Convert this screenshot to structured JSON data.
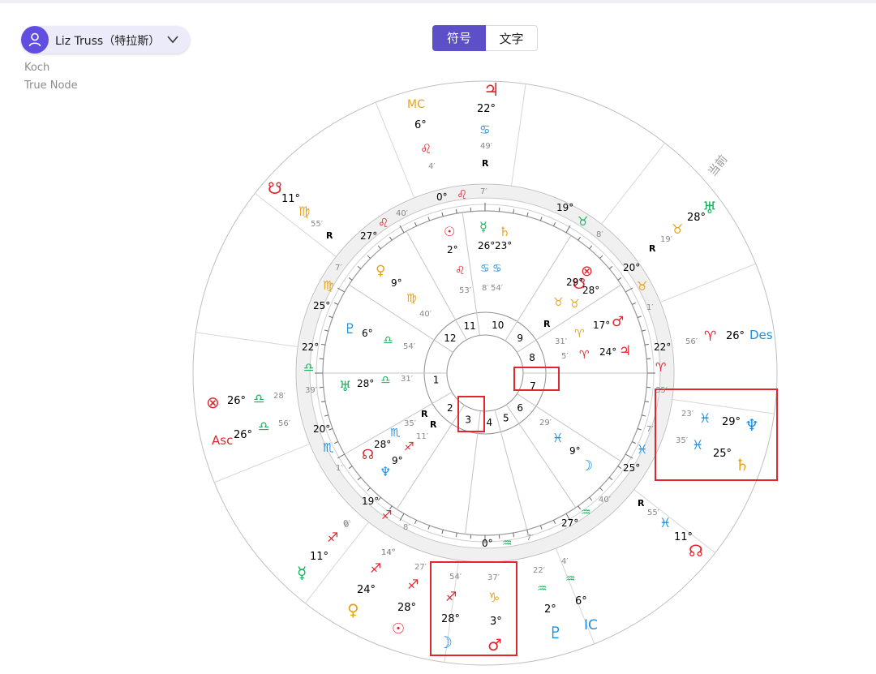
{
  "profile": {
    "name": "Liz Truss（特拉斯）",
    "house_system": "Koch",
    "node_type": "True Node"
  },
  "view_toggle": {
    "symbol_label": "符号",
    "text_label": "文字"
  },
  "outer_ring_label": "当前",
  "colors": {
    "fire": "#e0262e",
    "earth": "#e8a317",
    "air": "#13b35a",
    "water": "#1e8fe0",
    "accent": "#5c4fc8",
    "highlight": "#e0262e"
  },
  "houses": [
    "1",
    "2",
    "3",
    "4",
    "5",
    "6",
    "7",
    "8",
    "9",
    "10",
    "11",
    "12"
  ],
  "house_cusps": [
    {
      "deg": "0°",
      "sign": "♌",
      "min": "7′"
    },
    {
      "deg": "27°",
      "sign": "♌",
      "min": "40′"
    },
    {
      "deg": "25°",
      "sign": "♍",
      "min": "7′"
    },
    {
      "deg": "22°",
      "sign": "♎",
      "min": "39′"
    },
    {
      "deg": "20°",
      "sign": "♏",
      "min": "1′"
    },
    {
      "deg": "19°",
      "sign": "♐",
      "min": "0′"
    },
    {
      "deg": "14°",
      "sign": "",
      "min": "8′"
    },
    {
      "deg": "0°",
      "sign": "♒",
      "min": "7′"
    },
    {
      "deg": "27°",
      "sign": "♒",
      "min": "40′"
    },
    {
      "deg": "25°",
      "sign": "♓",
      "min": "7′"
    },
    {
      "deg": "22°",
      "sign": "♈",
      "min": "35′"
    },
    {
      "deg": "20°",
      "sign": "♉",
      "min": "1′"
    },
    {
      "deg": "19°",
      "sign": "♉",
      "min": "8′"
    }
  ],
  "natal_planets": [
    {
      "glyph": "☉",
      "deg": "2°",
      "sign": "♌",
      "min": "53′"
    },
    {
      "glyph": "☿",
      "deg": "26°",
      "sign": "♋",
      "min": "8′"
    },
    {
      "glyph": "♄",
      "deg": "23°",
      "sign": "♋",
      "min": "54′"
    },
    {
      "glyph": "♀",
      "deg": "9°",
      "sign": "♍",
      "min": "40′"
    },
    {
      "glyph": "♇",
      "deg": "6°",
      "sign": "♎",
      "min": "54′"
    },
    {
      "glyph": "♅",
      "deg": "28°",
      "sign": "♎",
      "min": "31′"
    },
    {
      "glyph": "☊",
      "deg": "28°",
      "sign": "♏",
      "min": "35′"
    },
    {
      "glyph": "♆",
      "deg": "9°",
      "sign": "♐",
      "min": "11′"
    },
    {
      "glyph": "♓",
      "deg": "9°",
      "sign": "♓",
      "min": "29′"
    },
    {
      "glyph": "☽",
      "deg": "9°",
      "sign": "♓",
      "min": ""
    },
    {
      "glyph": "☋",
      "deg": "28°",
      "sign": "♉",
      "min": "5′"
    },
    {
      "glyph": "⊗",
      "deg": "29°",
      "sign": "♉",
      "min": ""
    },
    {
      "glyph": "♂",
      "deg": "17°",
      "sign": "♈",
      "min": "31′"
    },
    {
      "glyph": "♃",
      "deg": "24°",
      "sign": "♈",
      "min": "5′"
    }
  ],
  "transit_planets": [
    {
      "glyph": "♃",
      "deg": "22°",
      "sign": "♋",
      "min": "49′",
      "retro": "R"
    },
    {
      "glyph": "MC",
      "deg": "6°",
      "sign": "♌",
      "min": "4′"
    },
    {
      "glyph": "☋",
      "deg": "11°",
      "sign": "♍",
      "min": "55′"
    },
    {
      "glyph": "♅",
      "deg": "28°",
      "sign": "♉",
      "min": "19′"
    },
    {
      "glyph": "Des",
      "deg": "26°",
      "sign": "♈",
      "min": "56′"
    },
    {
      "glyph": "♆",
      "deg": "29°",
      "sign": "♓",
      "min": "23′"
    },
    {
      "glyph": "♄",
      "deg": "25°",
      "sign": "♓",
      "min": "35′"
    },
    {
      "glyph": "☊",
      "deg": "11°",
      "sign": "♓",
      "min": "55′",
      "retro": "R"
    },
    {
      "glyph": "IC",
      "deg": "6°",
      "sign": "♒",
      "min": "4′"
    },
    {
      "glyph": "♇",
      "deg": "2°",
      "sign": "♒",
      "min": "22′"
    },
    {
      "glyph": "♂",
      "deg": "3°",
      "sign": "♑",
      "min": "37′"
    },
    {
      "glyph": "☽",
      "deg": "28°",
      "sign": "♐",
      "min": "54′"
    },
    {
      "glyph": "☉",
      "deg": "28°",
      "sign": "♐",
      "min": "27′"
    },
    {
      "glyph": "♀",
      "deg": "24°",
      "sign": "♐",
      "min": "14′"
    },
    {
      "glyph": "☿",
      "deg": "11°",
      "sign": "♐",
      "min": "0′"
    },
    {
      "glyph": "Asc",
      "deg": "26°",
      "sign": "♎",
      "min": "56′"
    },
    {
      "glyph": "⊗",
      "deg": "26°",
      "sign": "♎",
      "min": "28′"
    }
  ],
  "retro_marks": [
    "R",
    "R",
    "R",
    "R",
    "R",
    "R",
    "R",
    "R"
  ]
}
